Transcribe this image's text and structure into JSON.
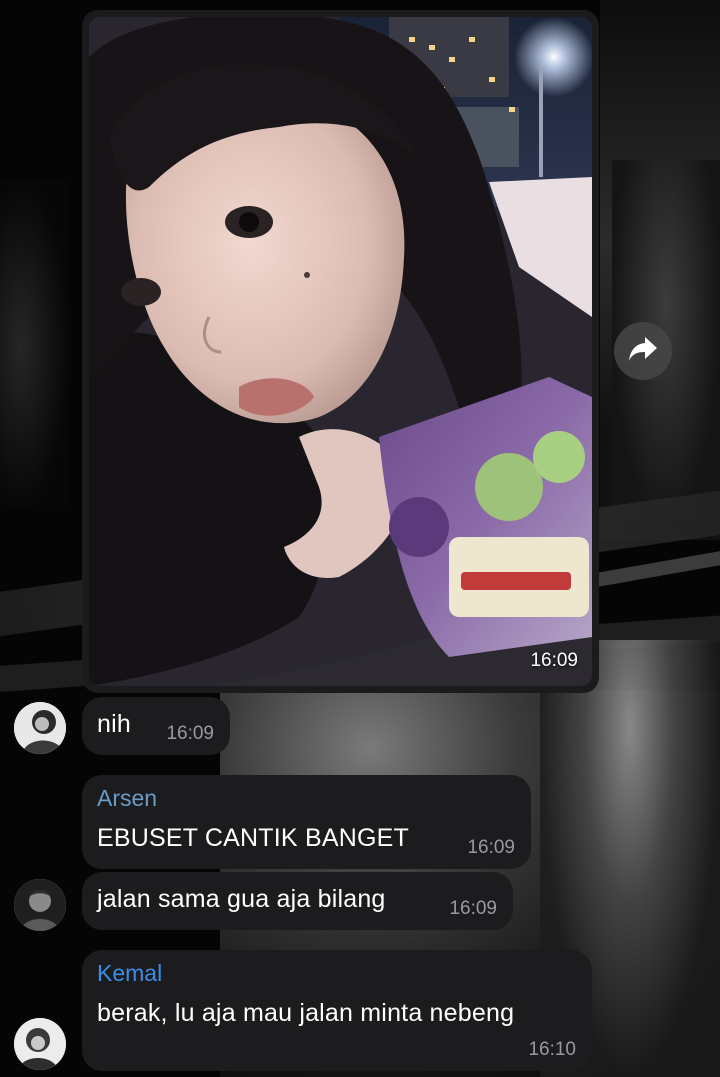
{
  "photo_message": {
    "time": "16:09"
  },
  "messages": [
    {
      "text": "nih",
      "time": "16:09"
    },
    {
      "sender": "Arsen",
      "sender_color": "#6a9cc9",
      "text": "EBUSET CANTIK BANGET",
      "time": "16:09"
    },
    {
      "text": "jalan sama gua aja bilang",
      "time": "16:09"
    },
    {
      "sender": "Kemal",
      "sender_color": "#3a8ee6",
      "text": "berak, lu aja mau jalan minta nebeng",
      "time": "16:10"
    }
  ],
  "icons": {
    "share": "share-forward-icon"
  },
  "colors": {
    "bubble": "#1c1c1e",
    "background": "#050505"
  }
}
